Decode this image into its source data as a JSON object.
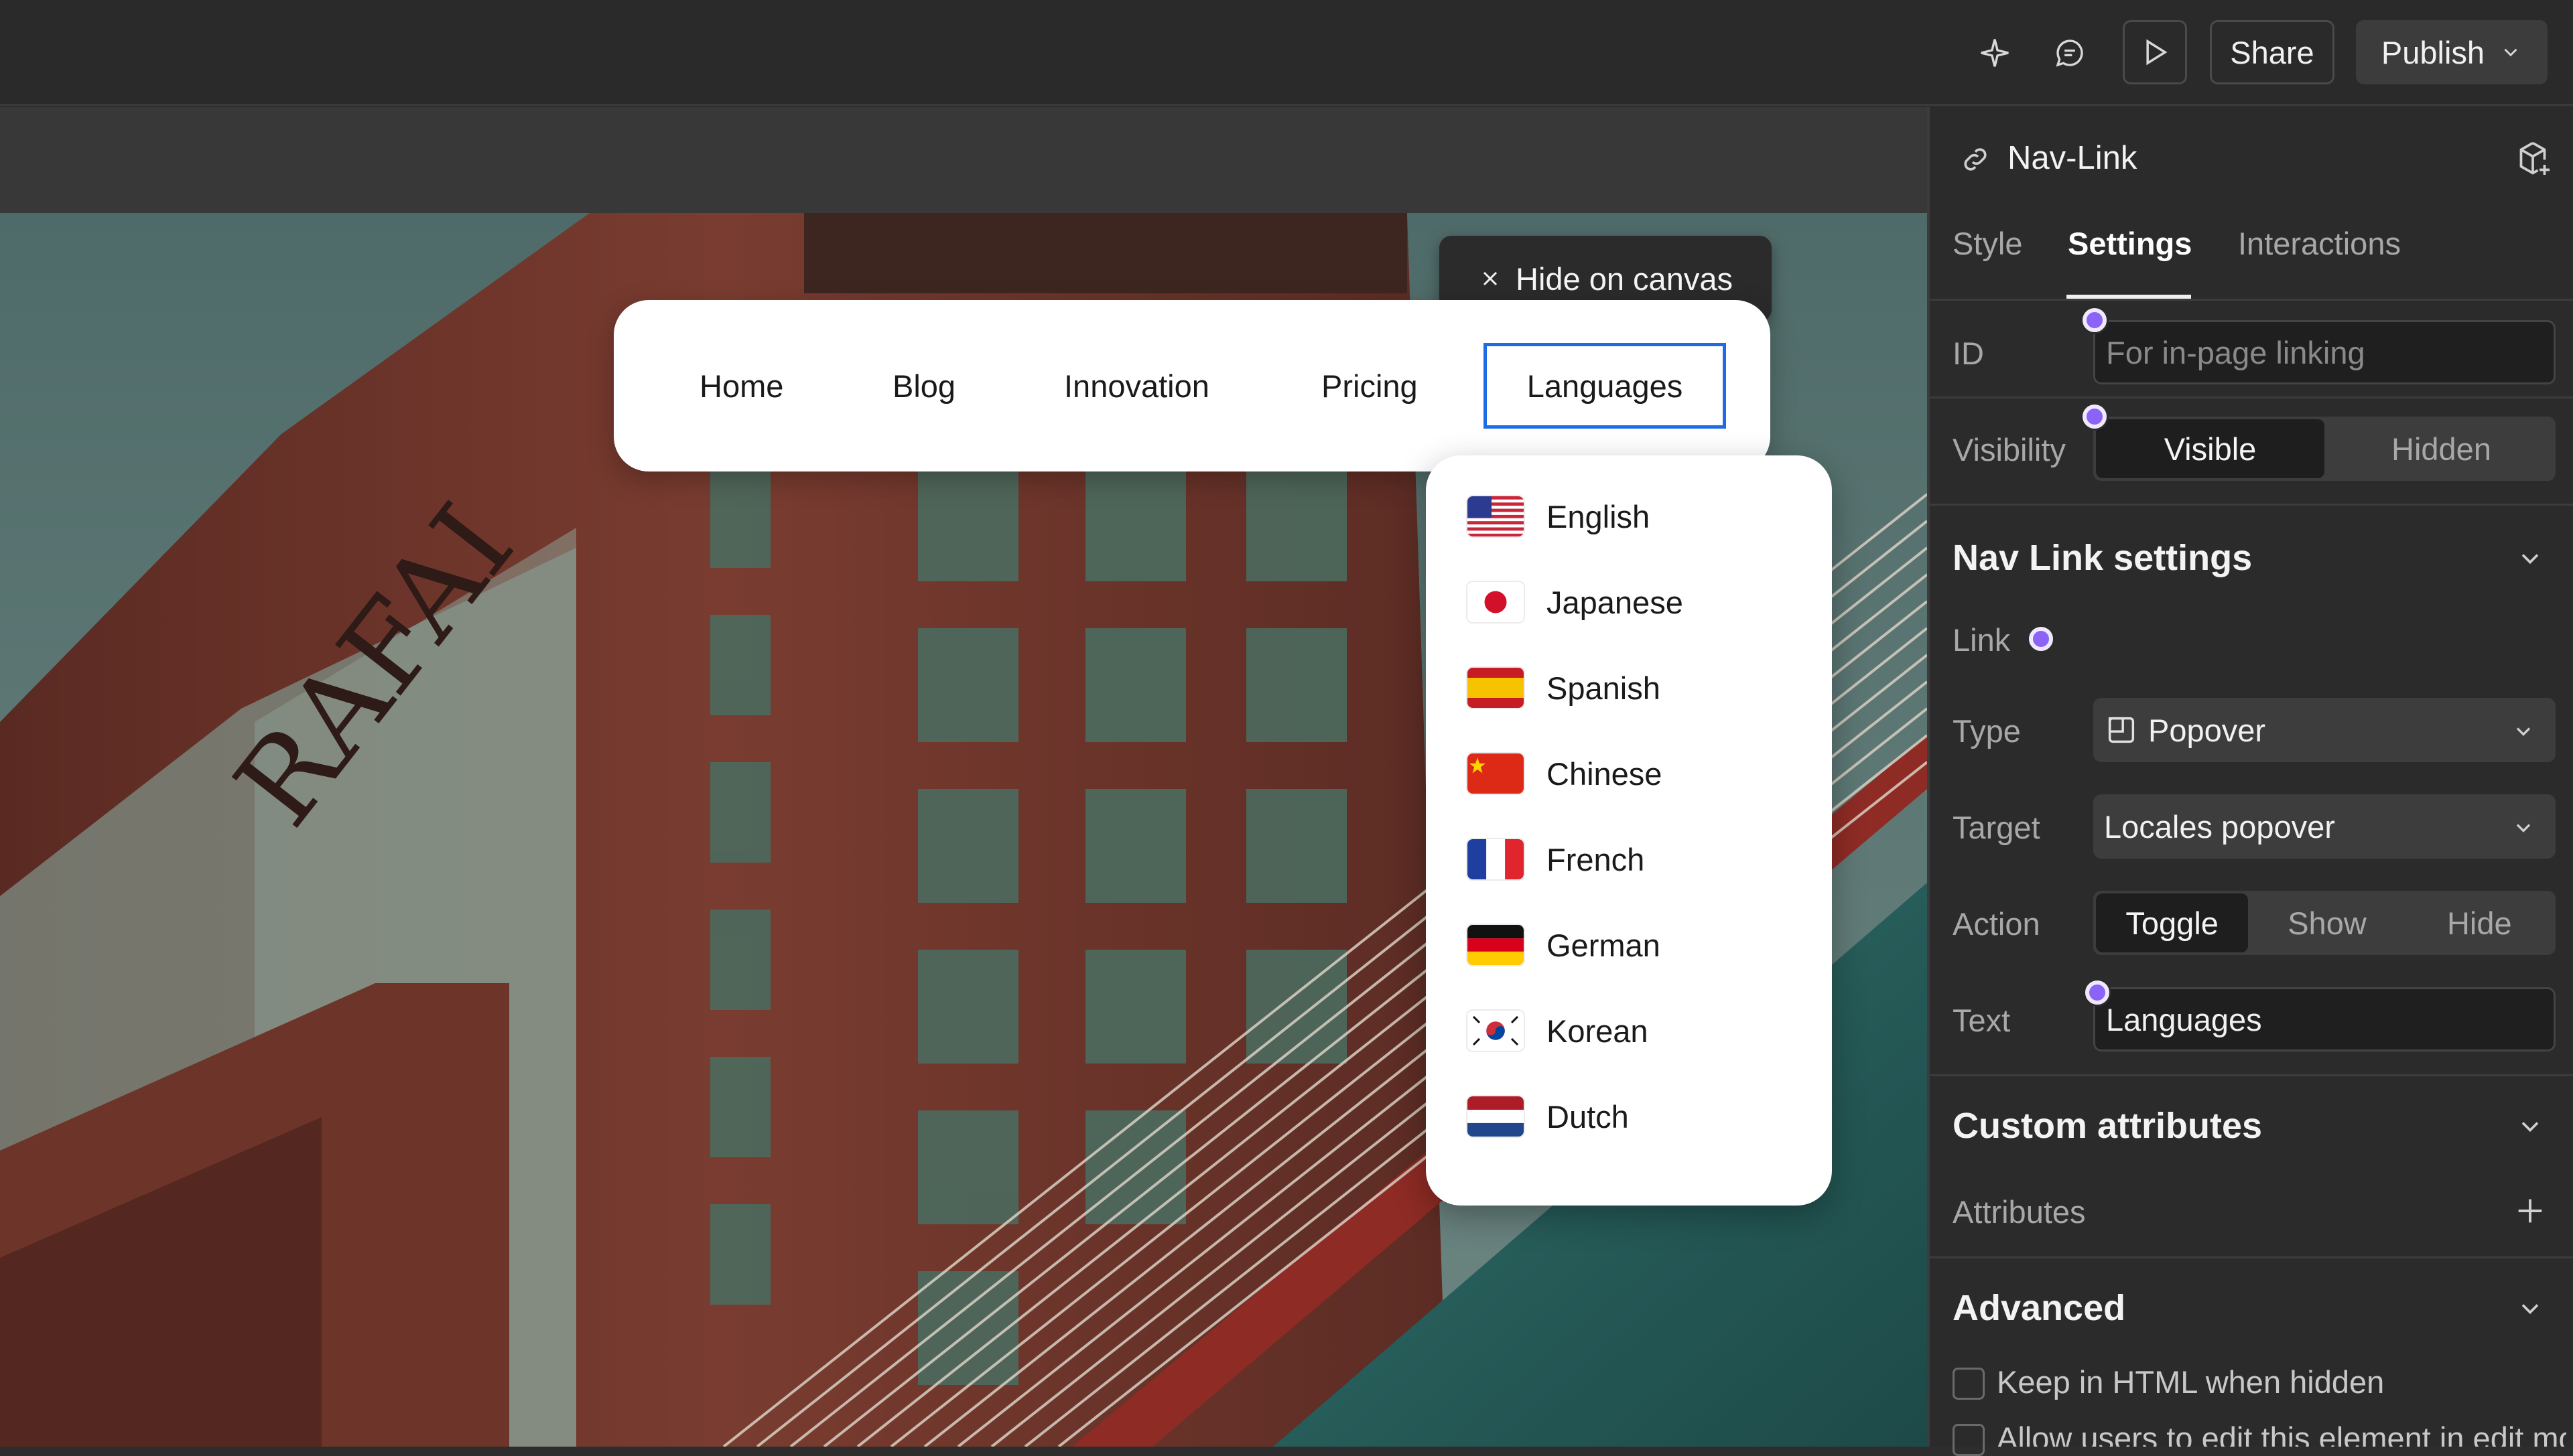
{
  "topbar": {
    "icons": [
      "sparkle-icon",
      "comment-icon"
    ],
    "preview_icon": "play-icon",
    "share_label": "Share",
    "publish_label": "Publish"
  },
  "canvas": {
    "hide_tag": "Hide on canvas",
    "nav_items": [
      "Home",
      "Blog",
      "Innovation",
      "Pricing",
      "Languages"
    ],
    "active_nav": "Languages",
    "photo_sign_text": "RAFAI",
    "languages": [
      {
        "label": "English",
        "flag": "us-flag-icon"
      },
      {
        "label": "Japanese",
        "flag": "japan-flag-icon"
      },
      {
        "label": "Spanish",
        "flag": "spain-flag-icon"
      },
      {
        "label": "Chinese",
        "flag": "china-flag-icon"
      },
      {
        "label": "French",
        "flag": "france-flag-icon"
      },
      {
        "label": "German",
        "flag": "germany-flag-icon"
      },
      {
        "label": "Korean",
        "flag": "korea-flag-icon"
      },
      {
        "label": "Dutch",
        "flag": "netherlands-flag-icon"
      }
    ]
  },
  "panel": {
    "element_name": "Nav-Link",
    "tabs": [
      "Style",
      "Settings",
      "Interactions"
    ],
    "active_tab": "Settings",
    "id_label": "ID",
    "id_placeholder": "For in-page linking",
    "visibility_label": "Visibility",
    "visibility_options": [
      "Visible",
      "Hidden"
    ],
    "visibility_value": "Visible",
    "nav_link_section": "Nav Link settings",
    "link_label": "Link",
    "type_label": "Type",
    "type_value": "Popover",
    "target_label": "Target",
    "target_value": "Locales popover",
    "action_label": "Action",
    "action_options": [
      "Toggle",
      "Show",
      "Hide"
    ],
    "action_value": "Toggle",
    "text_label": "Text",
    "text_value": "Languages",
    "custom_attr_section": "Custom attributes",
    "attributes_label": "Attributes",
    "advanced_section": "Advanced",
    "keep_html_label": "Keep in HTML when hidden",
    "allow_edit_label": "Allow users to edit this element in edit mode"
  },
  "colors": {
    "accent_purple": "#8b63f6",
    "selection_blue": "#1e6be6"
  }
}
